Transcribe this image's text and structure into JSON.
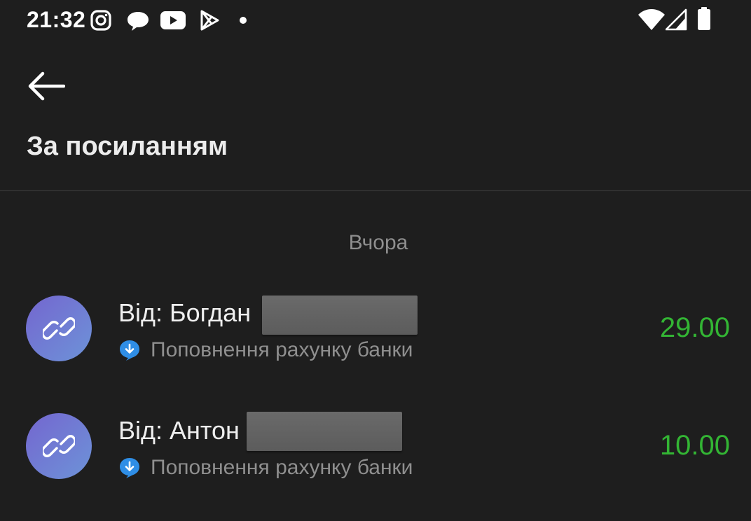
{
  "status_bar": {
    "time": "21:32",
    "notification_icons": [
      "instagram-icon",
      "chat-bubble-icon",
      "youtube-icon",
      "play-store-icon"
    ],
    "system_icons": [
      "wifi-icon",
      "cellular-signal-icon",
      "battery-icon"
    ]
  },
  "header": {
    "back_icon": "arrow-left-icon",
    "title": "За посиланням"
  },
  "section": {
    "date_label": "Вчора"
  },
  "transactions": [
    {
      "sender": "Від: Богдан",
      "description": "Поповнення рахунку банки",
      "amount": "29.00",
      "icon": "link-icon",
      "sub_icon": "download-badge-icon"
    },
    {
      "sender": "Від: Антон",
      "description": "Поповнення рахунку банки",
      "amount": "10.00",
      "icon": "link-icon",
      "sub_icon": "download-badge-icon"
    }
  ],
  "colors": {
    "background": "#1e1e1e",
    "amount_positive": "#33b534",
    "avatar_gradient_start": "#7466cf",
    "avatar_gradient_end": "#6d93d8",
    "badge_blue": "#2f8ee6"
  }
}
